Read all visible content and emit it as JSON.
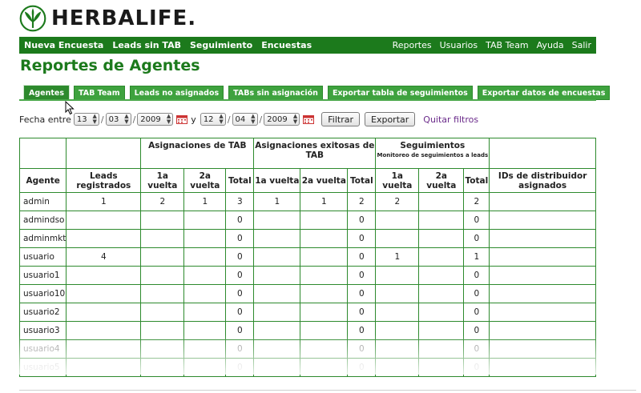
{
  "brand": {
    "name": "HERBALIFE",
    "mark": "."
  },
  "nav": {
    "left": [
      "Nueva Encuesta",
      "Leads sin TAB",
      "Seguimiento",
      "Encuestas"
    ],
    "right": [
      "Reportes",
      "Usuarios",
      "TAB Team",
      "Ayuda",
      "Salir"
    ]
  },
  "page_title": "Reportes de Agentes",
  "tabs": [
    "Agentes",
    "TAB Team",
    "Leads no asignados",
    "TABs sin asignación",
    "Exportar tabla de seguimientos",
    "Exportar datos de encuestas"
  ],
  "active_tab": "Agentes",
  "filters": {
    "label": "Fecha entre",
    "from": {
      "day": "13",
      "month": "03",
      "year": "2009"
    },
    "conj": "y",
    "to": {
      "day": "12",
      "month": "04",
      "year": "2009"
    },
    "filter_button": "Filtrar",
    "export_button": "Exportar",
    "clear_link": "Quitar filtros"
  },
  "table": {
    "group_headers": {
      "asignaciones": "Asignaciones de TAB",
      "exitosas": "Asignaciones exitosas de TAB",
      "seguimientos": "Seguimientos",
      "seguimientos_sub": "Monitoreo de seguimientos a leads"
    },
    "columns": [
      "Agente",
      "Leads registrados",
      "1a vuelta",
      "2a vuelta",
      "Total",
      "1a vuelta",
      "2a vuelta",
      "Total",
      "1a vuelta",
      "2a vuelta",
      "Total",
      "IDs de distribuidor asignados"
    ],
    "rows": [
      [
        "admin",
        "1",
        "2",
        "1",
        "3",
        "1",
        "1",
        "2",
        "2",
        "",
        "2",
        ""
      ],
      [
        "admindso",
        "",
        "",
        "",
        "0",
        "",
        "",
        "0",
        "",
        "",
        "0",
        ""
      ],
      [
        "adminmkt",
        "",
        "",
        "",
        "0",
        "",
        "",
        "0",
        "",
        "",
        "0",
        ""
      ],
      [
        "usuario",
        "4",
        "",
        "",
        "0",
        "",
        "",
        "0",
        "1",
        "",
        "1",
        ""
      ],
      [
        "usuario1",
        "",
        "",
        "",
        "0",
        "",
        "",
        "0",
        "",
        "",
        "0",
        ""
      ],
      [
        "usuario10",
        "",
        "",
        "",
        "0",
        "",
        "",
        "0",
        "",
        "",
        "0",
        ""
      ],
      [
        "usuario2",
        "",
        "",
        "",
        "0",
        "",
        "",
        "0",
        "",
        "",
        "0",
        ""
      ],
      [
        "usuario3",
        "",
        "",
        "",
        "0",
        "",
        "",
        "0",
        "",
        "",
        "0",
        ""
      ],
      [
        "usuario4",
        "",
        "",
        "",
        "0",
        "",
        "",
        "0",
        "",
        "",
        "0",
        ""
      ],
      [
        "usuario5",
        "",
        "",
        "",
        "0",
        "",
        "",
        "0",
        "",
        "",
        "0",
        ""
      ]
    ]
  },
  "colors": {
    "brand_green": "#1c7a1c",
    "tab_green": "#3ea23e",
    "link_purple": "#6a2a8a"
  }
}
